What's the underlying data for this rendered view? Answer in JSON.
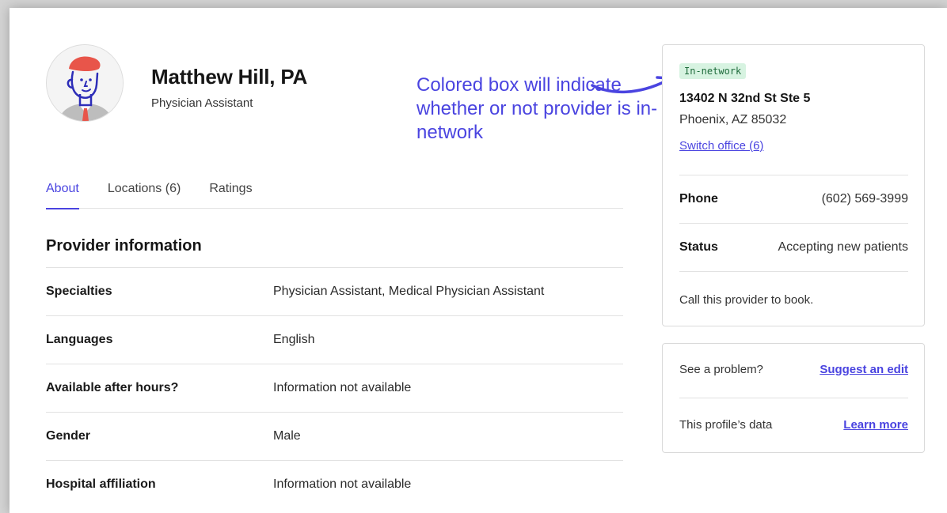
{
  "provider": {
    "name": "Matthew Hill, PA",
    "role": "Physician Assistant"
  },
  "annotation": {
    "text": "Colored box will indicate whether or not provider is in-network"
  },
  "tabs": [
    {
      "label": "About",
      "active": true
    },
    {
      "label": "Locations (6)",
      "active": false
    },
    {
      "label": "Ratings",
      "active": false
    }
  ],
  "info": {
    "title": "Provider information",
    "rows": [
      {
        "key": "Specialties",
        "value": "Physician Assistant, Medical Physician Assistant"
      },
      {
        "key": "Languages",
        "value": "English"
      },
      {
        "key": "Available after hours?",
        "value": "Information not available"
      },
      {
        "key": "Gender",
        "value": "Male"
      },
      {
        "key": "Hospital affiliation",
        "value": "Information not available"
      }
    ]
  },
  "office": {
    "badge": "In-network",
    "address_line1": "13402 N 32nd St Ste 5",
    "address_line2": "Phoenix, AZ 85032",
    "switch_link": "Switch office (6)",
    "phone_label": "Phone",
    "phone_value": "(602) 569-3999",
    "status_label": "Status",
    "status_value": "Accepting new patients",
    "note": "Call this provider to book."
  },
  "help": {
    "problem_label": "See a problem?",
    "problem_link": "Suggest an edit",
    "data_label": "This profile’s data",
    "data_link": "Learn more"
  },
  "colors": {
    "accent": "#4a44e0",
    "badge_bg": "#d7f3e1",
    "badge_text": "#1e6b3b",
    "avatar_hair": "#e8554a"
  },
  "icons": {
    "avatar": "illustrated-person-avatar",
    "arrow": "curved-arrow-icon"
  }
}
